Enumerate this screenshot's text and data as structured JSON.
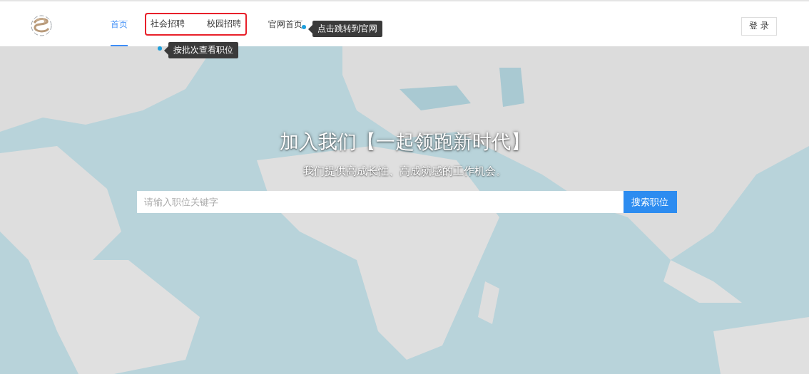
{
  "nav": [
    {
      "kind": "link",
      "label": "首页",
      "selected": true
    },
    {
      "kind": "annotated-group",
      "items": [
        {
          "label": "社会招聘",
          "selected": false
        },
        {
          "label": "校园招聘",
          "selected": false
        }
      ]
    },
    {
      "kind": "link",
      "label": "官网首页",
      "selected": false
    }
  ],
  "annotations": [
    {
      "text": "点击跳转到官网"
    },
    {
      "text": "按批次查看职位"
    }
  ],
  "login_button": "登 录",
  "hero": {
    "title": "加入我们【一起领跑新时代】",
    "subtitle": "我们提供高成长性、高成就感的工作机会。",
    "search": {
      "placeholder": "请输入职位关键字",
      "button": "搜索职位"
    }
  }
}
